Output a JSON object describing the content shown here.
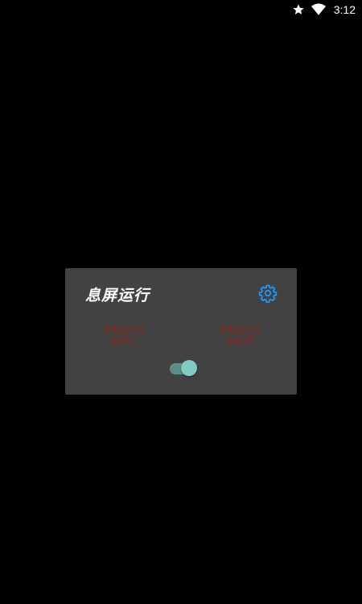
{
  "status_bar": {
    "time": "3:12",
    "icons": [
      "star-icon",
      "wifi-icon"
    ]
  },
  "dialog": {
    "title": "息屏运行",
    "settings_icon": "gear-icon",
    "left_status": {
      "line1": "SHIZUKU",
      "line2": "未运行"
    },
    "right_status": {
      "line1": "SHIZUKU",
      "line2": "未授权"
    },
    "toggle": {
      "on": true
    }
  },
  "colors": {
    "background": "#000000",
    "dialog_bg": "#424242",
    "accent": "#2196f3",
    "status_text": "#8b2a26",
    "switch_thumb": "#80cbc4",
    "switch_track": "#5b8e8a"
  }
}
